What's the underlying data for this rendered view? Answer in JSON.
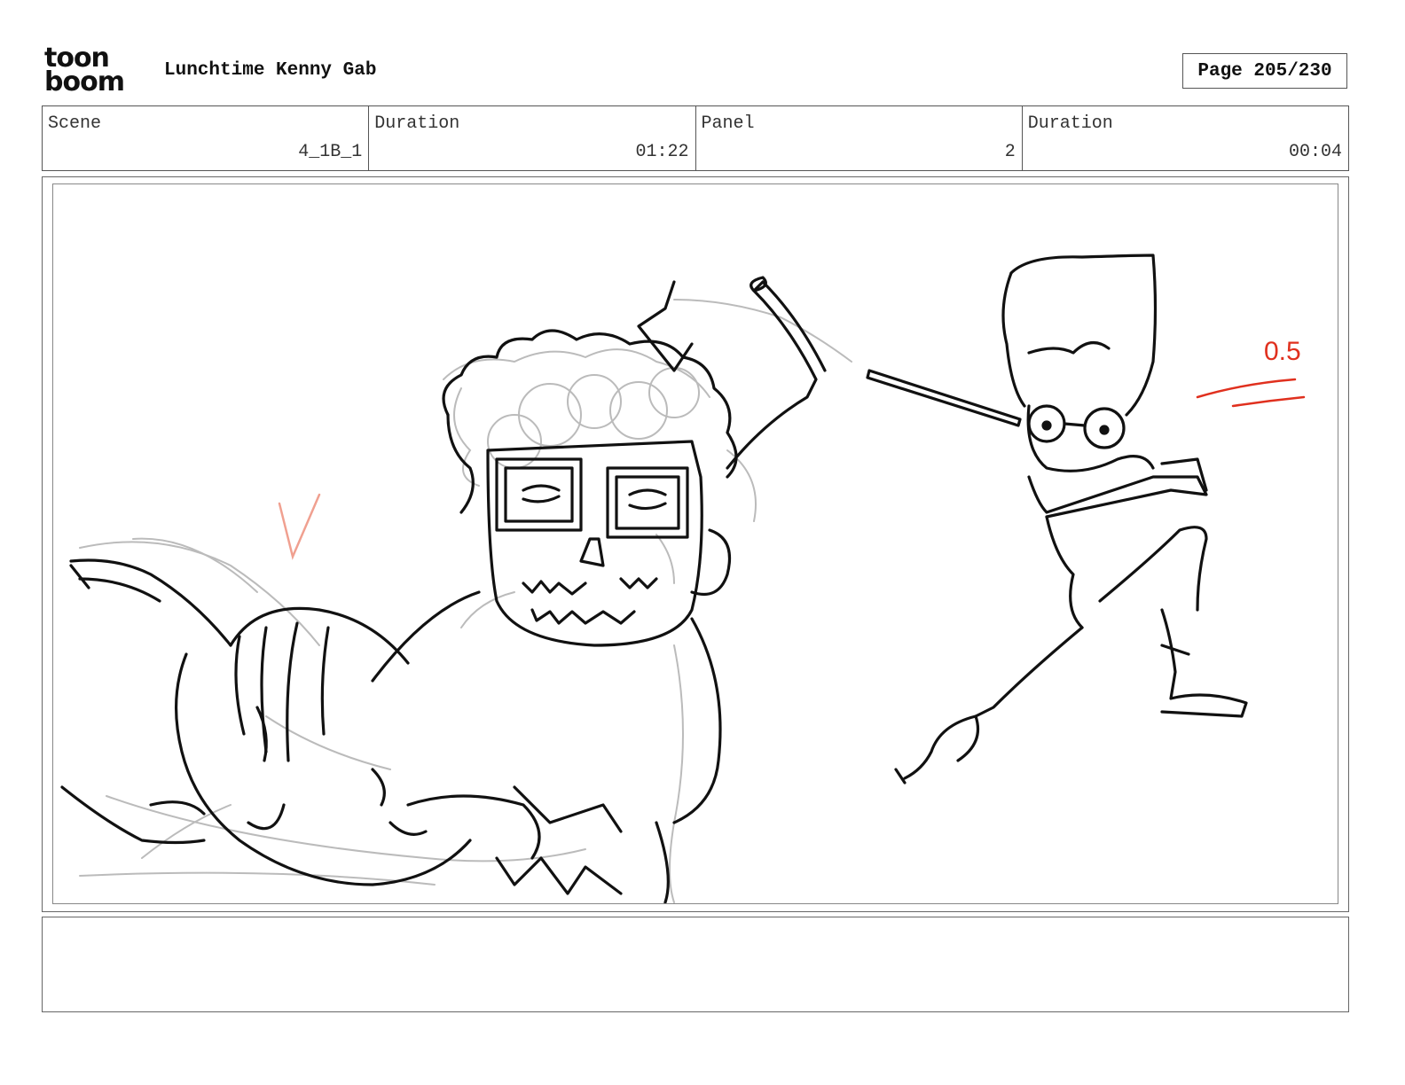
{
  "header": {
    "logo_line1": "toon",
    "logo_line2": "boom",
    "title": "Lunchtime Kenny Gab",
    "page": "Page 205/230"
  },
  "info": {
    "scene_label": "Scene",
    "scene_value": "4_1B_1",
    "duration_label": "Duration",
    "duration_value": "01:22",
    "panel_label": "Panel",
    "panel_value": "2",
    "panel_duration_label": "Duration",
    "panel_duration_value": "00:04"
  },
  "sketch": {
    "annotation": "0.5",
    "annotation_color": "#e0301e"
  },
  "notes": {
    "text": ""
  }
}
